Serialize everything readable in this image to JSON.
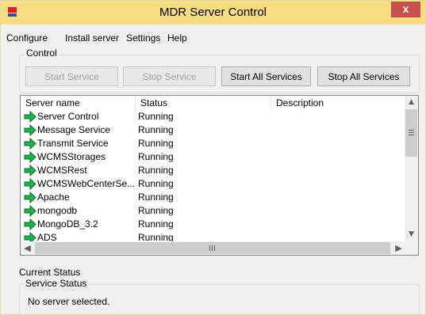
{
  "window": {
    "title": "MDR Server Control",
    "close_glyph": "x"
  },
  "menu": [
    "Configure",
    "Install server",
    "Settings",
    "Help"
  ],
  "control": {
    "label": "Control",
    "buttons": [
      {
        "label": "Start Service",
        "enabled": false
      },
      {
        "label": "Stop Service",
        "enabled": false
      },
      {
        "label": "Start All Services",
        "enabled": true
      },
      {
        "label": "Stop All Services",
        "enabled": true
      }
    ]
  },
  "list": {
    "columns": [
      "Server name",
      "Status",
      "Description"
    ],
    "rows": [
      {
        "name": "Server Control",
        "status": "Running",
        "icon": "green-arrow-icon"
      },
      {
        "name": "Message Service",
        "status": "Running",
        "icon": "green-arrow-icon"
      },
      {
        "name": "Transmit Service",
        "status": "Running",
        "icon": "green-arrow-icon"
      },
      {
        "name": "WCMSStorages",
        "status": "Running",
        "icon": "green-arrow-icon"
      },
      {
        "name": "WCMSRest",
        "status": "Running",
        "icon": "green-arrow-icon"
      },
      {
        "name": "WCMSWebCenterSe...",
        "status": "Running",
        "icon": "green-arrow-icon"
      },
      {
        "name": "Apache",
        "status": "Running",
        "icon": "green-arrow-icon"
      },
      {
        "name": "mongodb",
        "status": "Running",
        "icon": "green-arrow-icon"
      },
      {
        "name": "MongoDB_3.2",
        "status": "Running",
        "icon": "green-arrow-icon"
      },
      {
        "name": "ADS",
        "status": "Running",
        "icon": "green-arrow-icon"
      }
    ],
    "hscroll_grip": "III"
  },
  "current_status": {
    "label": "Current Status",
    "service_status_label": "Service Status",
    "message": "No server selected."
  }
}
